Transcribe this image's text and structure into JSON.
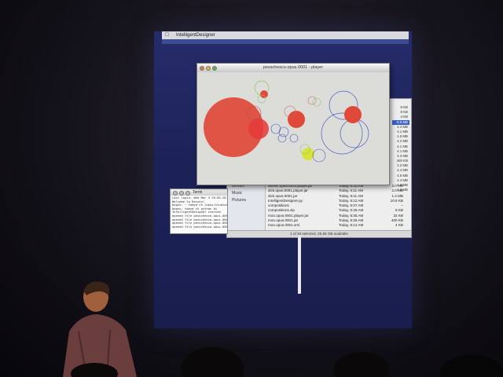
{
  "menubar": {
    "app_name": "IntelligentDesigner"
  },
  "player": {
    "title": "pesschesco.opus.0001 - player"
  },
  "terminal": {
    "title": "Termi",
    "lines": [
      "Last login: Wed Mar  3 20:05:28",
      "Welcome to Darwin!",
      "bogus: ~ tomyd ch /opus/studios",
      "bogus: tomyd ch python bi",
      "IntelligentDesigner started",
      "opened file pesschesco.opus.0001",
      "opened file pesschesco.opus.0001.",
      "opened file pesschesco.opus.0001.",
      "opened file pesschesco.opus.000"
    ]
  },
  "finder": {
    "sidebar": [
      "Movies",
      "Music",
      "Pictures"
    ],
    "files": [
      {
        "name": "atomic.opus.0001.player.jar",
        "date": "Today, 6:10 AM",
        "size": "2.0 MB"
      },
      {
        "name": "dick.opus.0001.player.jar",
        "date": "Today, 6:11 AM",
        "size": "2.0 MB"
      },
      {
        "name": "dick.opus.0001.jar",
        "date": "Today, 6:11 AM",
        "size": "1.4 MB"
      },
      {
        "name": "IntelligentDesigner.py",
        "date": "Today, 6:12 AM",
        "size": "10.8 KB"
      },
      {
        "name": "compositions",
        "date": "Today, 6:37 AM",
        "size": "--"
      },
      {
        "name": "compositions.zip",
        "date": "Today, 6:45 AM",
        "size": "8 KB"
      },
      {
        "name": "moo.opus.0001.player.jar",
        "date": "Today, 6:35 AM",
        "size": "32 KB"
      },
      {
        "name": "moo.opus.0001.jar",
        "date": "Today, 6:35 AM",
        "size": "400 KB"
      },
      {
        "name": "moo.opus.0001.xml",
        "date": "Today, 6:12 AM",
        "size": "4 KB"
      }
    ],
    "size_column": [
      "8 KB",
      "8 KB",
      "4 KB",
      "8.9 MB",
      "4.4 MB",
      "4.1 MB",
      "4.5 MB",
      "4.2 MB",
      "4.1 MB",
      "4.1 MB",
      "4.3 MB",
      "400 KB",
      "2.3 MB",
      "4.4 MB",
      "4.5 MB",
      "4.4 MB",
      "4.3 MB",
      "4.3 MB"
    ],
    "selected_size_index": 3,
    "status": "1 of 46 selected, 25.65 GB available"
  },
  "canvas": {
    "circle_colors": {
      "filled_red": "#e0483a",
      "filled_yellow": "#d8e23a",
      "outline_blue": "#4a5cc8",
      "outline_green": "#8cc86e"
    }
  }
}
